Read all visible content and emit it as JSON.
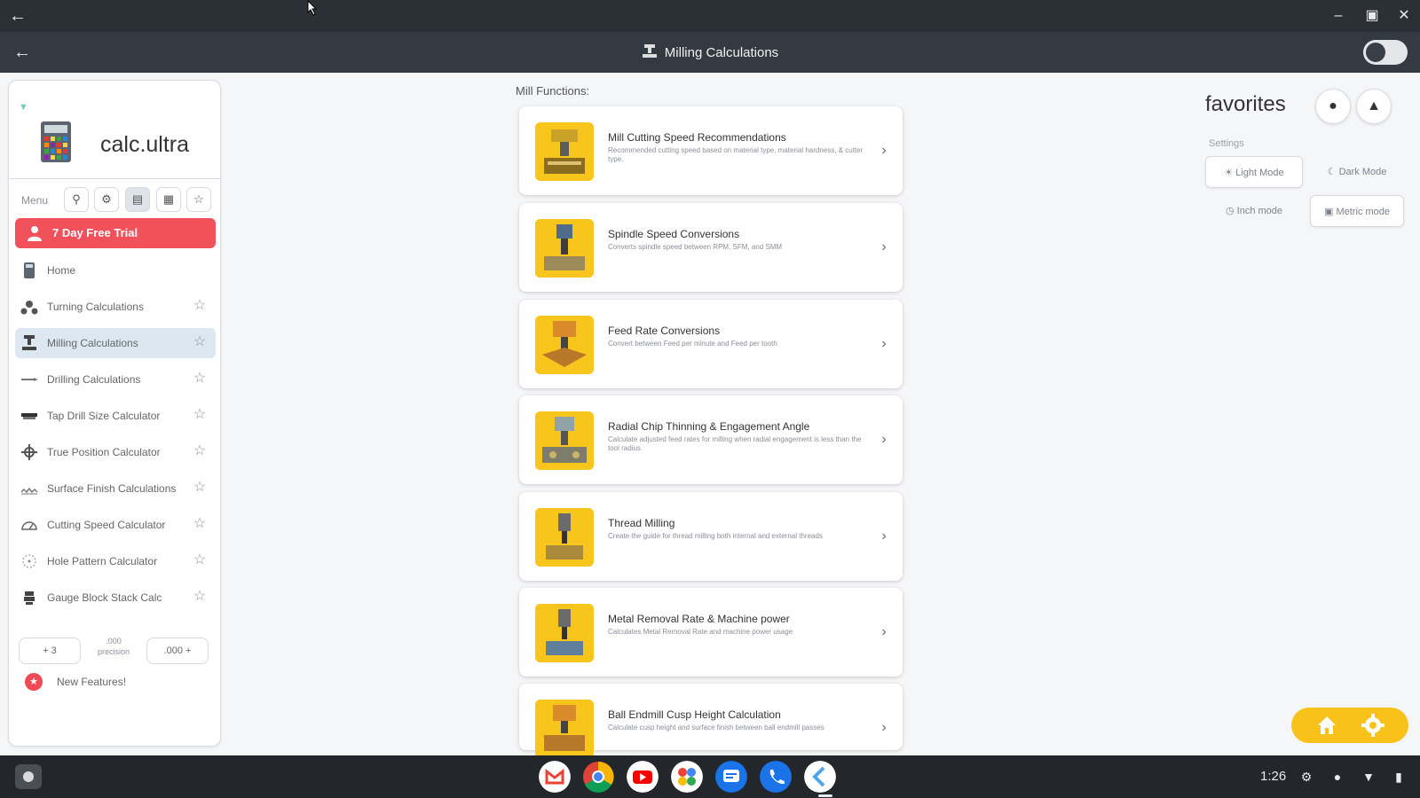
{
  "window": {
    "back_icon": "arrow-left-icon",
    "controls": [
      "minimize-icon",
      "maximize-icon",
      "close-icon"
    ]
  },
  "appbar": {
    "title": "Milling Calculations",
    "title_icon": "mill-icon",
    "toggle_on": true
  },
  "sidebar": {
    "logo_text": "calc.ultra",
    "menu_label": "Menu",
    "menu_tools": [
      "search-icon",
      "gear-icon",
      "list-view-icon",
      "grid-view-icon",
      "star-outline-icon"
    ],
    "trial_label": "7 Day Free Trial",
    "items": [
      {
        "label": "Home",
        "icon": "calculator-icon",
        "star": false,
        "active": false
      },
      {
        "label": "Turning Calculations",
        "icon": "lathe-icon",
        "star": true,
        "active": false
      },
      {
        "label": "Milling Calculations",
        "icon": "mill-icon",
        "star": true,
        "active": true
      },
      {
        "label": "Drilling Calculations",
        "icon": "drill-icon",
        "star": true,
        "active": false
      },
      {
        "label": "Tap Drill Size Calculator",
        "icon": "tap-icon",
        "star": true,
        "active": false
      },
      {
        "label": "True Position Calculator",
        "icon": "crosshair-icon",
        "star": true,
        "active": false
      },
      {
        "label": "Surface Finish Calculations",
        "icon": "surface-icon",
        "star": true,
        "active": false
      },
      {
        "label": "Cutting Speed Calculator",
        "icon": "speed-icon",
        "star": true,
        "active": false
      },
      {
        "label": "Hole Pattern Calculator",
        "icon": "hole-pattern-icon",
        "star": true,
        "active": false
      },
      {
        "label": "Gauge Block Stack Calc",
        "icon": "gauge-block-icon",
        "star": true,
        "active": false
      }
    ],
    "precision_left": "+ 3",
    "precision_value": ".000",
    "precision_label": "precision",
    "precision_right": ".000 +",
    "new_features_label": "New Features!"
  },
  "main": {
    "section_label": "Mill Functions:",
    "cards": [
      {
        "title": "Mill Cutting Speed Recommendations",
        "desc": "Recommended cutting speed based on material type, material hardness, & cutter type."
      },
      {
        "title": "Spindle Speed Conversions",
        "desc": "Converts spindle speed between RPM, SFM, and SMM"
      },
      {
        "title": "Feed Rate Conversions",
        "desc": "Convert between Feed per minute and Feed per tooth"
      },
      {
        "title": "Radial Chip Thinning & Engagement Angle",
        "desc": "Calculate adjusted feed rates for milling when radial engagement is less than the tool radius"
      },
      {
        "title": "Thread Milling",
        "desc": "Create the guide for thread milling both internal and external threads"
      },
      {
        "title": "Metal Removal Rate & Machine power",
        "desc": "Calculates Metal Removal Rate and machine power usage"
      },
      {
        "title": "Ball Endmill Cusp Height Calculation",
        "desc": "Calculate cusp height and surface finish between ball endmill passes"
      }
    ]
  },
  "favorites": {
    "title": "favorites",
    "buttons": [
      "apple-icon",
      "lathe-icon"
    ],
    "settings_label": "Settings",
    "light_mode": "Light Mode",
    "dark_mode": "Dark Mode",
    "inch_mode": "Inch mode",
    "metric_mode": "Metric mode"
  },
  "fab": {
    "home_icon": "home-icon",
    "settings_icon": "gear-icon"
  },
  "shelf": {
    "apps": [
      "gmail-icon",
      "chrome-icon",
      "youtube-icon",
      "photos-icon",
      "messages-icon",
      "phone-icon",
      "calc-ultra-icon"
    ],
    "time": "1:26"
  },
  "colors": {
    "titlebar": "#2b2f36",
    "appbar": "#343a42",
    "trial": "#f0515a",
    "active_nav": "#dce7f2",
    "accent_yellow": "#f8c21a"
  }
}
